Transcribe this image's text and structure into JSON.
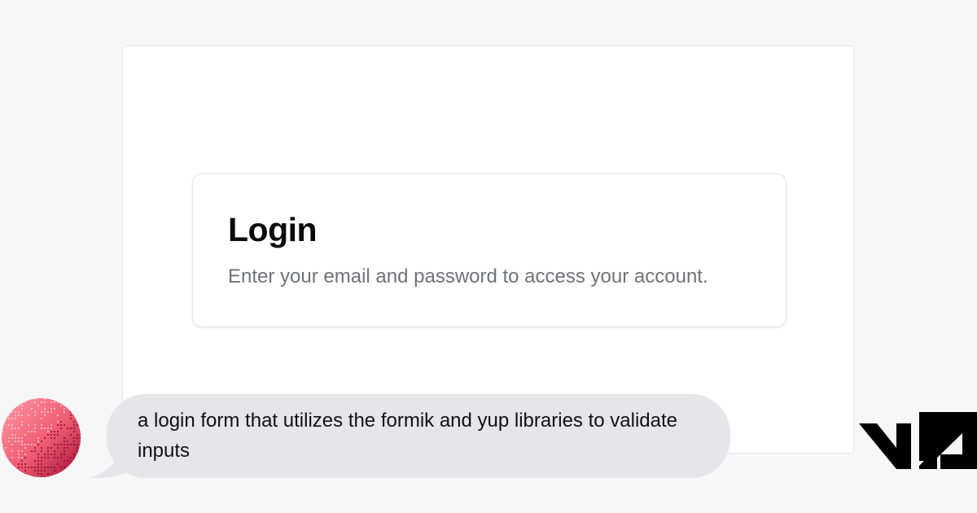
{
  "preview": {
    "login": {
      "title": "Login",
      "description": "Enter your email and password to access your account."
    }
  },
  "prompt": {
    "text": "a login form that utilizes the formik and yup libraries to validate inputs"
  },
  "brand": {
    "logo_text": "v0"
  },
  "colors": {
    "avatar_light": "#ff8a95",
    "avatar_dark": "#b3163e",
    "bubble": "#e6e6e8",
    "title": "#0a0a0a",
    "description": "#71717a"
  }
}
